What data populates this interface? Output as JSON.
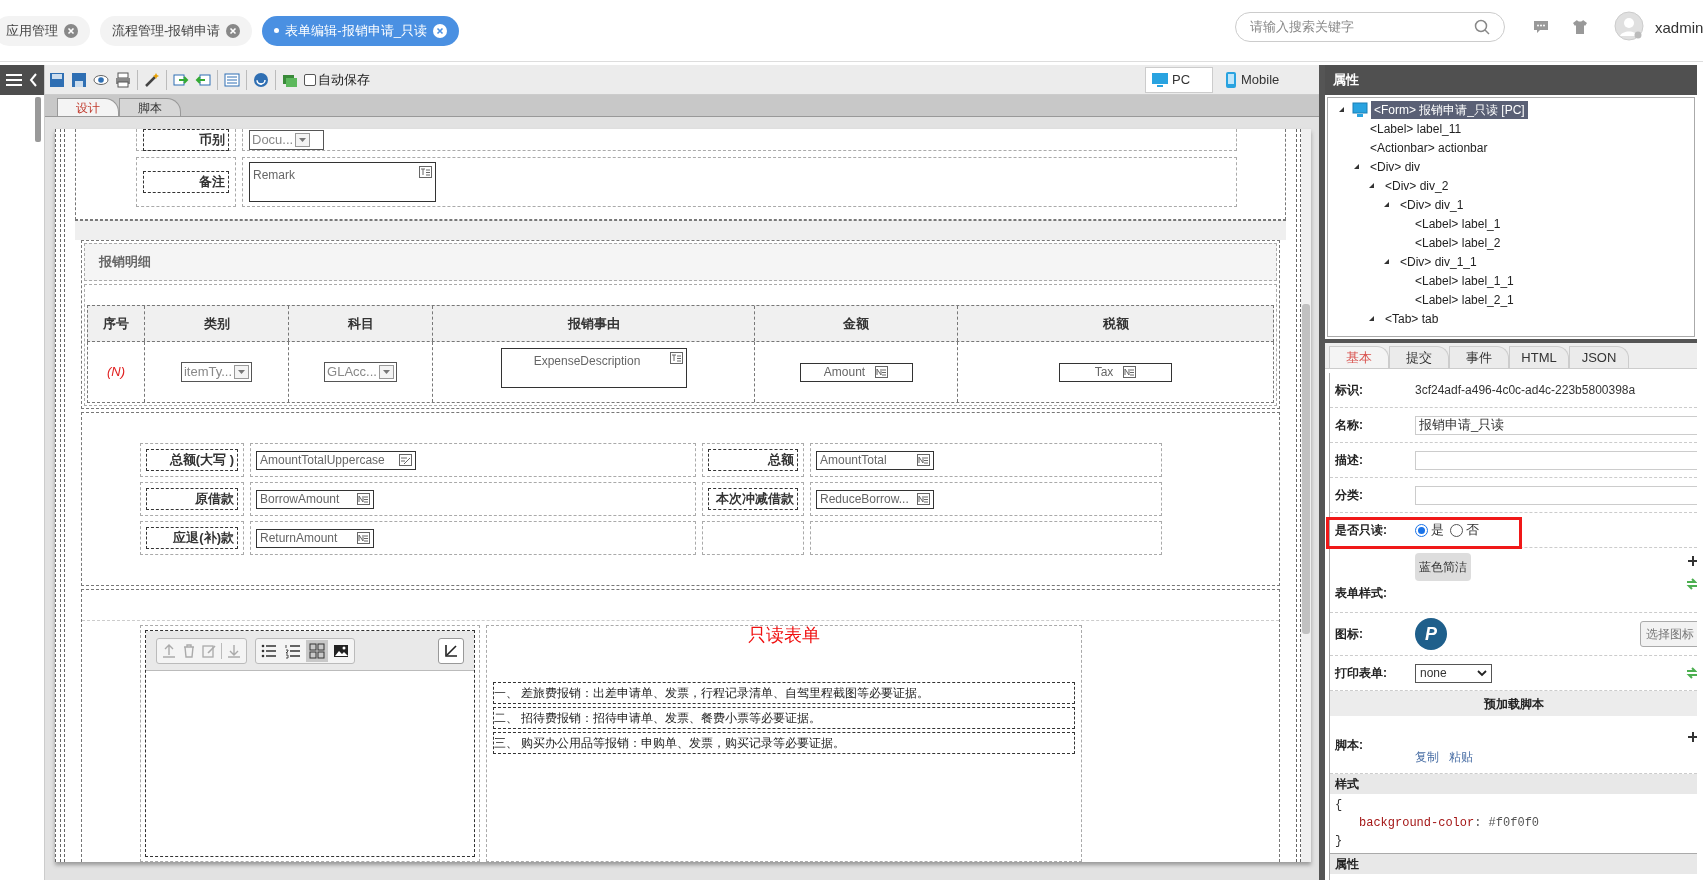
{
  "app_tabs": [
    {
      "label": "应用管理",
      "selected": false
    },
    {
      "label": "流程管理-报销申请",
      "selected": false
    },
    {
      "label": "表单编辑-报销申请_只读",
      "selected": true
    }
  ],
  "search": {
    "placeholder": "请输入搜索关键字"
  },
  "user": {
    "name": "xadmin"
  },
  "toolbar": {
    "autosave": {
      "label": "自动保存",
      "checked": false
    },
    "view_modes": [
      {
        "label": "PC",
        "kind": "pc",
        "selected": true
      },
      {
        "label": "Mobile",
        "kind": "mobile",
        "selected": false
      }
    ]
  },
  "editor_tabs": [
    {
      "label": "设计",
      "selected": true
    },
    {
      "label": "脚本",
      "selected": false
    }
  ],
  "form": {
    "top_fields": [
      {
        "label": "币别",
        "kind": "select",
        "value": "Docu..."
      },
      {
        "label": "备注",
        "kind": "textarea",
        "value": "Remark"
      }
    ],
    "detail": {
      "title": "报销明细",
      "columns": [
        "序号",
        "类别",
        "科目",
        "报销事由",
        "金额",
        "税额"
      ],
      "row": [
        {
          "kind": "index",
          "text": "(N)"
        },
        {
          "kind": "select",
          "text": "itemTy..."
        },
        {
          "kind": "select",
          "text": "GLAcc..."
        },
        {
          "kind": "textarea",
          "text": "ExpenseDescription"
        },
        {
          "kind": "number",
          "text": "Amount"
        },
        {
          "kind": "number",
          "text": "Tax"
        }
      ]
    },
    "summary": [
      [
        {
          "label": "总额(大写 )",
          "field": "AmountTotalUppercase",
          "kind": "uppercase"
        },
        {
          "label": "总额",
          "field": "AmountTotal",
          "kind": "number"
        }
      ],
      [
        {
          "label": "原借款",
          "field": "BorrowAmount",
          "kind": "number"
        },
        {
          "label": "本次冲减借款",
          "field": "ReduceBorrow...",
          "kind": "number"
        }
      ],
      [
        {
          "label": "应退(补)款",
          "field": "ReturnAmount",
          "kind": "number"
        }
      ]
    ],
    "notice": {
      "title": "只读表单",
      "lines": [
        "一、 差旅费报销：出差申请单、发票，行程记录清单、自驾里程截图等必要证据。",
        "二、 招待费报销：招待申请单、发票、餐费小票等必要证据。",
        "三、 购买办公用品等报销：申购单、发票，购买记录等必要证据。"
      ]
    }
  },
  "panel": {
    "title": "属性",
    "tree": [
      {
        "label": "<Form> 报销申请_只读 [PC]",
        "selected": true,
        "expanded": true,
        "children": [
          {
            "label": "<Label> label_11",
            "selected": false
          },
          {
            "label": "<Actionbar> actionbar",
            "selected": false
          },
          {
            "label": "<Div> div",
            "selected": false,
            "expanded": true,
            "children": [
              {
                "label": "<Div> div_2",
                "selected": false,
                "expanded": true,
                "children": [
                  {
                    "label": "<Div> div_1",
                    "selected": false,
                    "expanded": true,
                    "children": [
                      {
                        "label": "<Label> label_1",
                        "selected": false
                      },
                      {
                        "label": "<Label> label_2",
                        "selected": false
                      }
                    ]
                  },
                  {
                    "label": "<Div> div_1_1",
                    "selected": false,
                    "expanded": true,
                    "children": [
                      {
                        "label": "<Label> label_1_1",
                        "selected": false
                      },
                      {
                        "label": "<Label> label_2_1",
                        "selected": false
                      }
                    ]
                  }
                ]
              },
              {
                "label": "<Tab> tab",
                "selected": false,
                "expanded": true
              }
            ]
          }
        ]
      }
    ],
    "tabs": [
      {
        "label": "基本",
        "selected": true
      },
      {
        "label": "提交",
        "selected": false
      },
      {
        "label": "事件",
        "selected": false
      },
      {
        "label": "HTML",
        "selected": false
      },
      {
        "label": "JSON",
        "selected": false
      }
    ],
    "id": {
      "label": "标识:",
      "value": "3cf24adf-a496-4c0c-ad4c-223b5800398a"
    },
    "name": {
      "label": "名称:",
      "value": "报销申请_只读"
    },
    "description": {
      "label": "描述:"
    },
    "category": {
      "label": "分类:"
    },
    "readonly": {
      "label": "是否只读:",
      "highlighted": true,
      "options": [
        {
          "label": "是",
          "selected": true
        },
        {
          "label": "否",
          "selected": false
        }
      ]
    },
    "style": {
      "label": "表单样式:",
      "button": "蓝色简洁"
    },
    "icon": {
      "label": "图标:",
      "letter": "P",
      "button": "选择图标"
    },
    "print": {
      "label": "打印表单:",
      "value": "none"
    },
    "preload": {
      "title": "预加载脚本",
      "label": "脚本:",
      "links": [
        "复制",
        "粘贴"
      ]
    },
    "css": {
      "title": "样式",
      "open": "{",
      "property": "background-color",
      "value": ": #f0f0f0",
      "close": "}"
    },
    "next_section": "属性"
  }
}
